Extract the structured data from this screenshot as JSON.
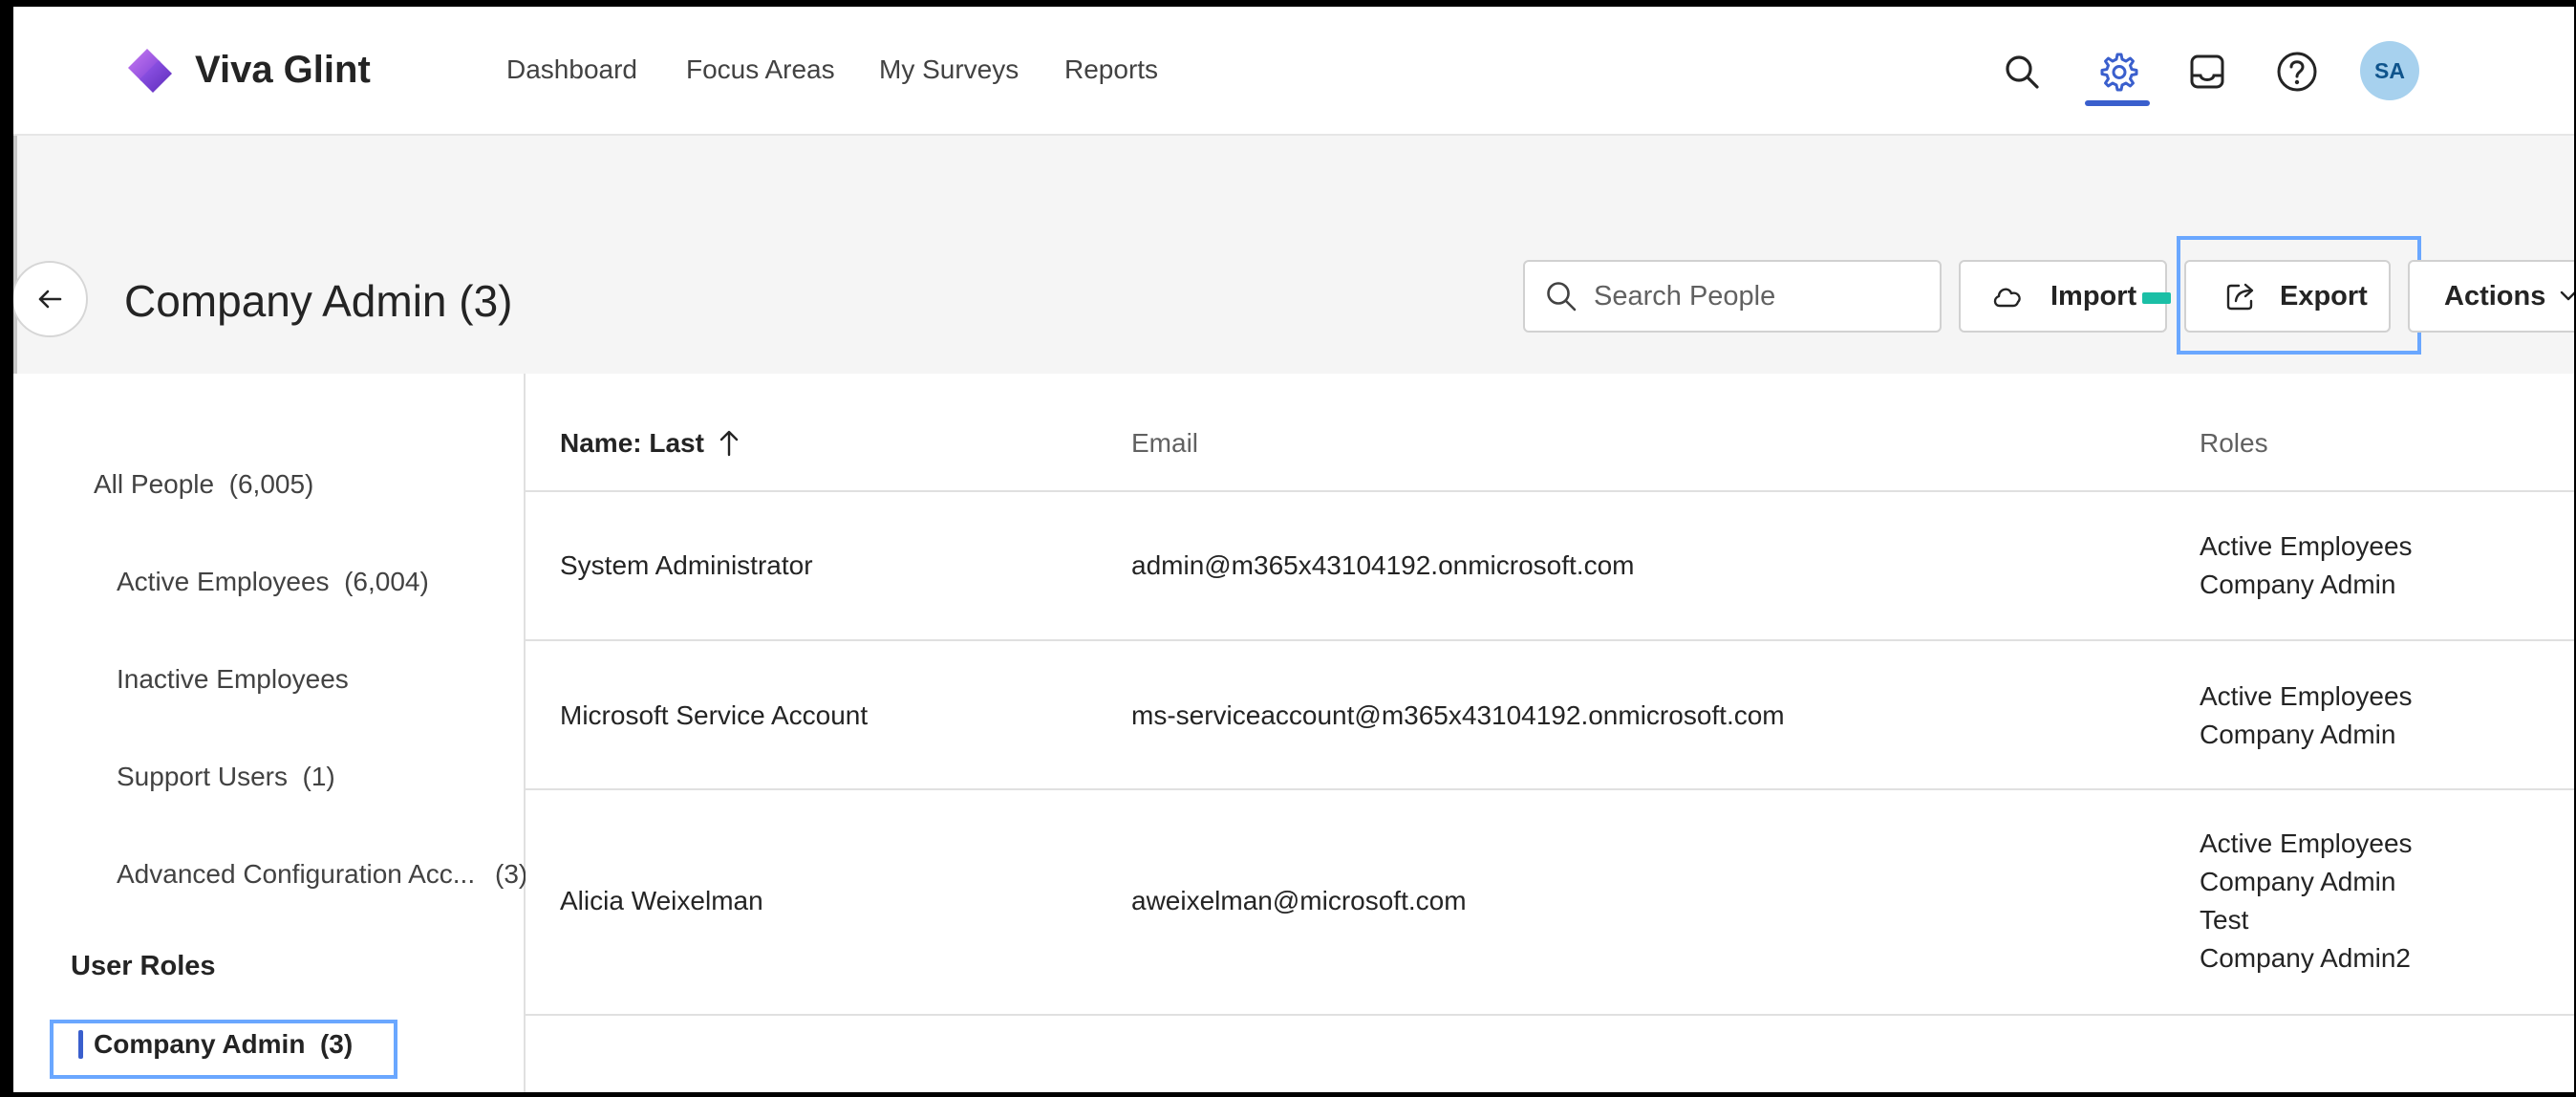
{
  "app": {
    "brand": "Viva Glint",
    "nav": [
      "Dashboard",
      "Focus Areas",
      "My Surveys",
      "Reports"
    ],
    "avatar_initials": "SA"
  },
  "header": {
    "title": "Company Admin (3)",
    "search_placeholder": "Search People",
    "import_label": "Import",
    "export_label": "Export",
    "actions_label": "Actions"
  },
  "sidebar": {
    "all_people": {
      "label": "All People",
      "count": "(6,005)"
    },
    "items": [
      {
        "label": "Active Employees",
        "count": "(6,004)"
      },
      {
        "label": "Inactive Employees",
        "count": ""
      },
      {
        "label": "Support Users",
        "count": "(1)"
      },
      {
        "label": "Advanced Configuration Acc...",
        "count": "(3)"
      }
    ],
    "section_heading": "User Roles",
    "active_item": {
      "label": "Company Admin",
      "count": "(3)"
    }
  },
  "table": {
    "columns": {
      "name": "Name: Last",
      "email": "Email",
      "roles": "Roles"
    },
    "rows": [
      {
        "name": "System Administrator",
        "email": "admin@m365x43104192.onmicrosoft.com",
        "roles": [
          "Active Employees",
          "Company Admin"
        ]
      },
      {
        "name": "Microsoft Service Account",
        "email": "ms-serviceaccount@m365x43104192.onmicrosoft.com",
        "roles": [
          "Active Employees",
          "Company Admin"
        ]
      },
      {
        "name": "Alicia Weixelman",
        "email": "aweixelman@microsoft.com",
        "roles": [
          "Active Employees",
          "Company Admin",
          "Test",
          "Company Admin2"
        ]
      }
    ]
  },
  "colors": {
    "accent": "#3a5fcd",
    "highlight": "#6aa7ff",
    "avatar_bg": "#a7d1ee"
  },
  "icons": [
    "logo-icon",
    "search-icon",
    "gear-icon",
    "inbox-icon",
    "help-icon",
    "back-arrow-icon",
    "cloud-icon",
    "share-icon",
    "chevron-down-icon",
    "sort-up-arrow-icon"
  ]
}
